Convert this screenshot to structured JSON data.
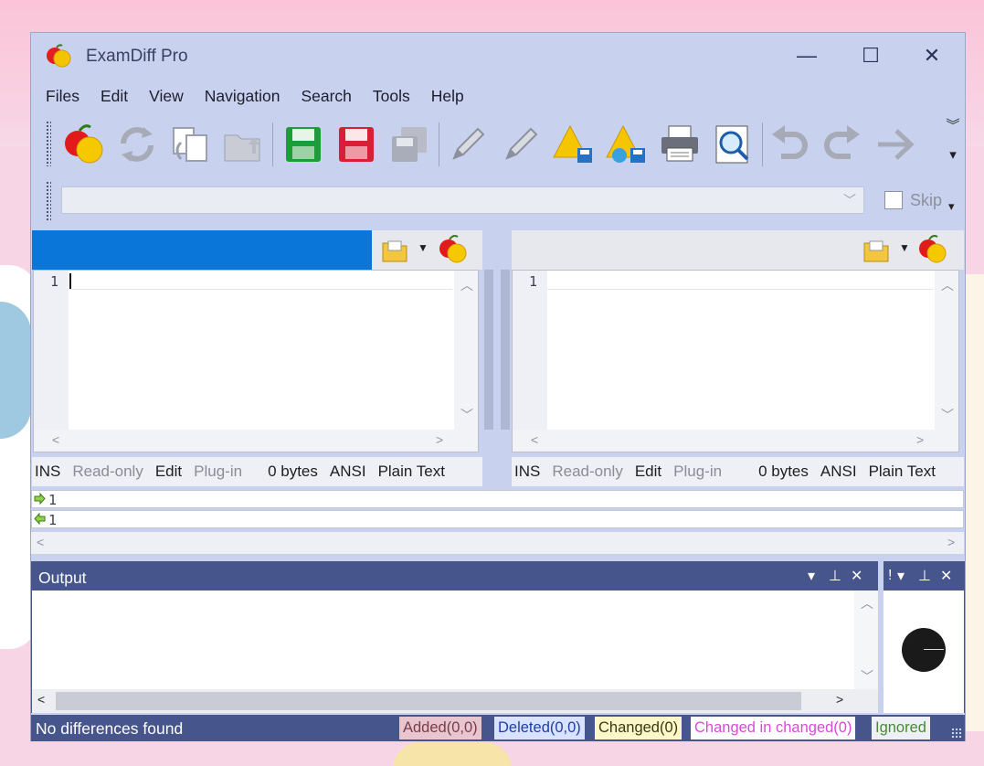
{
  "window": {
    "title": "ExamDiff Pro",
    "controls": {
      "minimize": "—",
      "maximize": "☐",
      "close": "✕"
    }
  },
  "menu": [
    "Files",
    "Edit",
    "View",
    "Navigation",
    "Search",
    "Tools",
    "Help"
  ],
  "toolbar": {
    "icons": [
      "compare-icon",
      "refresh-icon",
      "swap-icon",
      "open-folder-icon",
      "save-icon",
      "save-red-icon",
      "save-all-icon",
      "edit-left-icon",
      "edit-right-icon",
      "warning-save-icon",
      "warning-globe-icon",
      "print-icon",
      "zoom-icon",
      "undo-icon",
      "redo-icon",
      "next-arrow-icon",
      "overflow-icon"
    ]
  },
  "pathbar": {
    "value": "",
    "skip_label": "Skip",
    "skip_checked": false
  },
  "left_pane": {
    "filename": "",
    "line_number": "1",
    "status": {
      "mode": "INS",
      "readonly": "Read-only",
      "edit": "Edit",
      "plugin": "Plug-in",
      "size": "0 bytes",
      "encoding": "ANSI",
      "type": "Plain Text"
    }
  },
  "right_pane": {
    "filename": "",
    "line_number": "1",
    "status": {
      "mode": "INS",
      "readonly": "Read-only",
      "edit": "Edit",
      "plugin": "Plug-in",
      "size": "0 bytes",
      "encoding": "ANSI",
      "type": "Plain Text"
    }
  },
  "compare_lines": [
    {
      "num": "1",
      "direction": "right"
    },
    {
      "num": "1",
      "direction": "left"
    }
  ],
  "output": {
    "title": "Output",
    "side_title": "!"
  },
  "statusbar": {
    "message": "No differences found",
    "added": "Added(0,0)",
    "deleted": "Deleted(0,0)",
    "changed": "Changed(0)",
    "changed_in_changed": "Changed in changed(0)",
    "ignored": "Ignored"
  },
  "colors": {
    "window_bg": "#c8d2ee",
    "accent_blue": "#0a76d9",
    "panel_header": "#46558b",
    "added_bg": "#e7c6cf",
    "deleted_bg": "#d9e2ff",
    "changed_bg": "#fbf7c8",
    "changed_in_changed_fg": "#d84ad8",
    "ignored_fg": "#4a8a35"
  }
}
